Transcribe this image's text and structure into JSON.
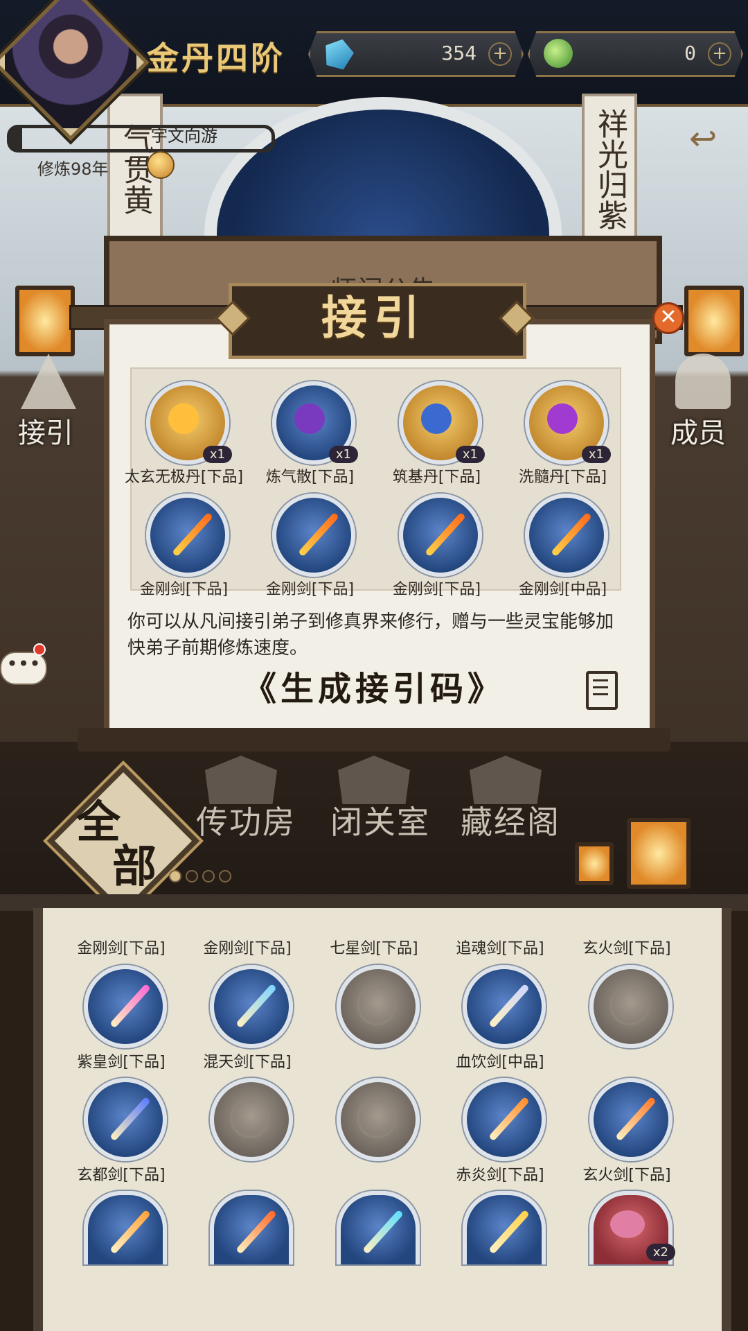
{
  "header": {
    "rank": "金丹四阶",
    "resources": [
      {
        "icon": "blue-gem-icon",
        "value": "354"
      },
      {
        "icon": "jade-token-icon",
        "value": "0"
      }
    ],
    "plus_symbol": "+"
  },
  "player": {
    "name": "宇文向游",
    "years": "修炼98年"
  },
  "scene": {
    "banner_left": "气贯黄",
    "banner_right": "祥光归紫",
    "notice_title": "师门公告",
    "side_left_label": "接引",
    "side_right_label": "成员",
    "chat_glyph": "•••",
    "back_glyph": "↩"
  },
  "halls": {
    "all_label_1": "全",
    "all_label_2": "部",
    "items": [
      "传功房",
      "闭关室",
      "藏经阁"
    ]
  },
  "modal": {
    "title": "接引",
    "close_glyph": "✕",
    "rewards": [
      {
        "name": "太玄无极丹[下品]",
        "count": "x1",
        "orb": "gold"
      },
      {
        "name": "炼气散[下品]",
        "count": "x1",
        "orb": "blue"
      },
      {
        "name": "筑基丹[下品]",
        "count": "x1",
        "orb": "gold"
      },
      {
        "name": "洗髓丹[下品]",
        "count": "x1",
        "orb": "gold"
      },
      {
        "name": "金刚剑[下品]",
        "count": "",
        "orb": "blue"
      },
      {
        "name": "金刚剑[下品]",
        "count": "",
        "orb": "blue"
      },
      {
        "name": "金刚剑[下品]",
        "count": "",
        "orb": "blue"
      },
      {
        "name": "金刚剑[中品]",
        "count": "",
        "orb": "blue"
      }
    ],
    "description": "你可以从凡间接引弟子到修真界来修行，赠与一些灵宝能够加快弟子前期修炼速度。",
    "generate_button": "《生成接引码》"
  },
  "inventory": {
    "top_labels": [
      "金刚剑[下品]",
      "金刚剑[下品]",
      "七星剑[下品]",
      "追魂剑[下品]",
      "玄火剑[下品]"
    ],
    "rows": [
      {
        "orbs": [
          "blue",
          "blue",
          "grey",
          "blue",
          "grey"
        ],
        "labels": [
          "紫皇剑[下品]",
          "混天剑[下品]",
          "",
          "血饮剑[中品]",
          ""
        ]
      },
      {
        "orbs": [
          "blue",
          "grey",
          "grey",
          "blue",
          "blue"
        ],
        "labels": [
          "玄都剑[下品]",
          "",
          "",
          "赤炎剑[下品]",
          "玄火剑[下品]"
        ]
      },
      {
        "orbs": [
          "blue",
          "blue",
          "blue",
          "blue",
          "red"
        ],
        "labels": [
          "",
          "",
          "",
          "",
          ""
        ],
        "last_count": "x2"
      }
    ]
  },
  "colors": {
    "sword_colors": [
      "#ff6ad5",
      "#7fd4ff",
      "#9aa0a8",
      "#cfd6ff",
      "#a89e94",
      "#5b7bff",
      "#a89e94",
      "#a89e94",
      "#ff8c2a",
      "#ff7a2a",
      "#ffa23a",
      "#ff6a2a",
      "#5ee0ff",
      "#ffd24a"
    ]
  }
}
